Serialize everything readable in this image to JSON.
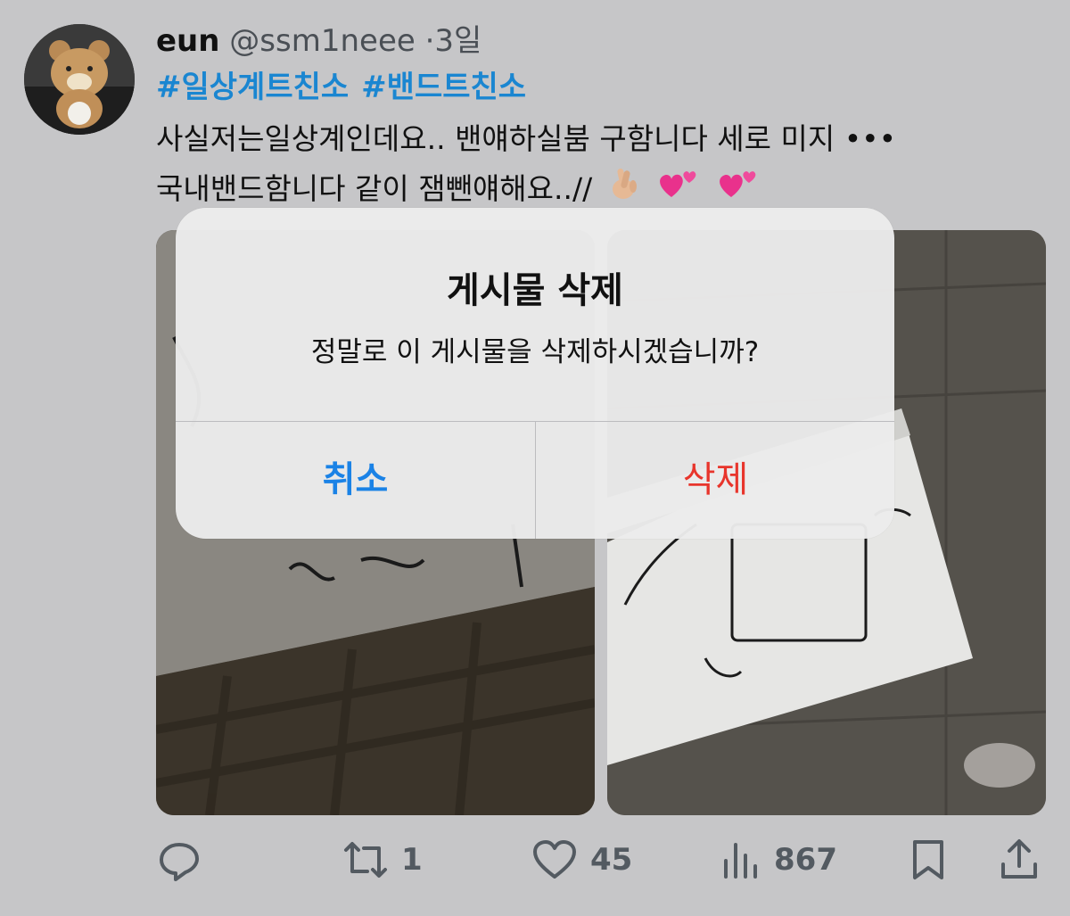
{
  "tweet": {
    "display_name": "eun",
    "handle": "@ssm1neee",
    "separator": "·",
    "time": "3일",
    "hashtags": [
      "#일상계트친소",
      "#밴드트친소"
    ],
    "text_line1": "사실저는일상계인데요.. 밴얘하실붐 구함니다 세로 미지 •••",
    "text_line2": "국내밴드함니다 같이 잼뺀얘해요..//",
    "emojis": [
      "crossed-fingers-emoji",
      "two-hearts-emoji",
      "two-hearts-emoji"
    ]
  },
  "actions": {
    "reply_count": "",
    "retweet_count": "1",
    "like_count": "45",
    "views_count": "867"
  },
  "dialog": {
    "title": "게시물 삭제",
    "message": "정말로 이 게시물을 삭제하시겠습니까?",
    "cancel_label": "취소",
    "delete_label": "삭제"
  },
  "colors": {
    "link_blue": "#1a86d1",
    "cancel_blue": "#1a82e6",
    "delete_red": "#e8352c",
    "icon_gray": "#535a61"
  }
}
